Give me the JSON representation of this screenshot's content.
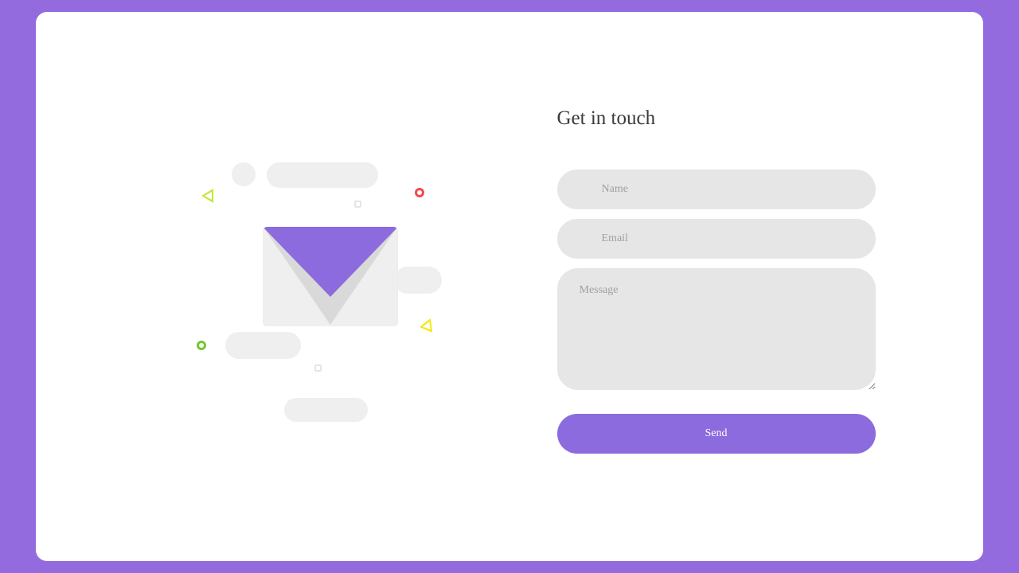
{
  "form": {
    "title": "Get in touch",
    "name_placeholder": "Name",
    "name_value": "",
    "email_placeholder": "Email",
    "email_value": "",
    "message_placeholder": "Message",
    "message_value": "",
    "send_label": "Send"
  },
  "colors": {
    "page_bg": "#936bdf",
    "accent": "#8b6bdd",
    "field_bg": "#e6e6e6"
  }
}
